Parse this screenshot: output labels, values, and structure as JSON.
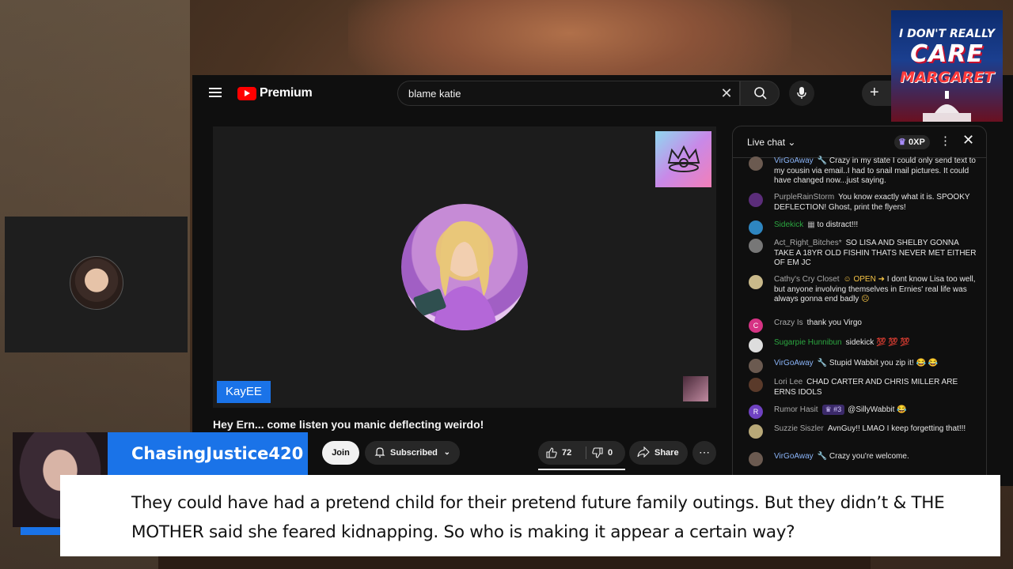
{
  "youtube": {
    "logo_text": "Premium",
    "search": {
      "value": "blame katie"
    },
    "player": {
      "presenter_name": "KayEE"
    },
    "video_title": "Hey Ern... come listen you manic deflecting weirdo!",
    "actions": {
      "join": "Join",
      "subscribe": "Subscribed",
      "likes": "72",
      "dislikes": "0",
      "share": "Share"
    },
    "live_chat": {
      "title": "Live chat",
      "xp": "0XP",
      "messages": [
        {
          "author": "VirGoAway",
          "author_color": "blue",
          "text": "Crazy in my state I could only send text to my cousin via email..I had to snail mail pictures. It could have changed now...just saying."
        },
        {
          "author": "PurpleRainStorm",
          "author_color": "gray",
          "text": "You know exactly what it is. SPOOKY DEFLECTION! Ghost, print the flyers!"
        },
        {
          "author": "Sidekick",
          "author_color": "green",
          "text": "to distract!!!"
        },
        {
          "author": "Act_Right_Bitches*",
          "author_color": "gray",
          "text": "SO LISA AND SHELBY GONNA TAKE A 18YR OLD FISHIN THATS NEVER MET EITHER OF EM JC"
        },
        {
          "author": "Cathy's Cry Closet",
          "author_color": "gray",
          "text": "I dont know Lisa too well, but anyone involving themselves in Ernies' real life was always gonna end badly"
        },
        {
          "author": "Crazy Is",
          "author_color": "gray",
          "text": "thank you Virgo"
        },
        {
          "author": "Sugarpie Hunnibun",
          "author_color": "green",
          "text": "sidekick 💯 💯 💯"
        },
        {
          "author": "VirGoAway",
          "author_color": "blue",
          "text": "Stupid Wabbit you zip it! 😂 😂"
        },
        {
          "author": "Lori Lee",
          "author_color": "gray",
          "text": "CHAD CARTER AND CHRIS MILLER ARE ERNS IDOLS"
        },
        {
          "author": "Rumor Hasit",
          "author_color": "gray",
          "rank": "#3",
          "text": "@SillyWabbit 😂"
        },
        {
          "author": "Suzzie Siszler",
          "author_color": "gray",
          "text": "AvnGuy!! LMAO I keep forgetting that!!!"
        },
        {
          "author": "VirGoAway",
          "author_color": "blue",
          "text": "Crazy you're welcome."
        }
      ]
    }
  },
  "stream_logo": {
    "line1": "I DON'T REALLY",
    "line2": "CARE",
    "line3": "MARGARET"
  },
  "comment_overlay": {
    "username": "ChasingJustice420",
    "text": "They could have had a pretend child for their pretend future family outings. But they didn’t & THE MOTHER said she feared kidnapping. So who is making it appear a certain way?"
  },
  "colors": {
    "accent_blue": "#1a73e8",
    "youtube_red": "#ff0000",
    "chat_bg": "#0f0f0f"
  }
}
